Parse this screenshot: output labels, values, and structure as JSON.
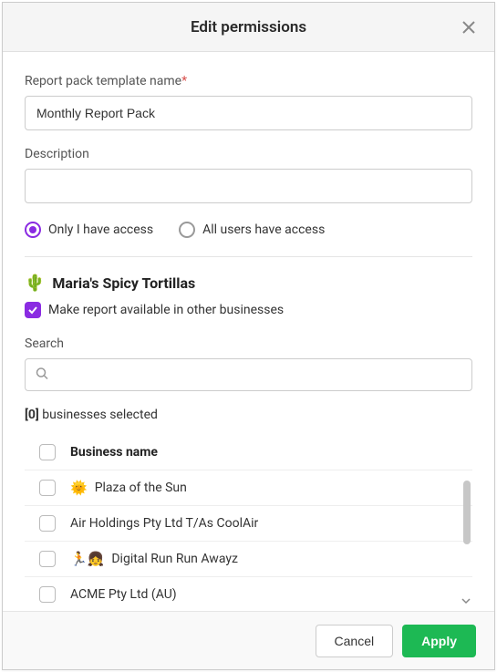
{
  "header": {
    "title": "Edit permissions"
  },
  "fields": {
    "name_label": "Report pack template name",
    "name_value": "Monthly Report Pack",
    "desc_label": "Description",
    "desc_value": ""
  },
  "access": {
    "only_me": "Only I have access",
    "all_users": "All users have access"
  },
  "business": {
    "icon": "🌵",
    "name": "Maria's Spicy Tortillas",
    "share_label": "Make report available in other businesses"
  },
  "search": {
    "label": "Search",
    "value": ""
  },
  "selection": {
    "count": "[0]",
    "suffix": " businesses selected"
  },
  "table": {
    "header": "Business name",
    "rows": [
      {
        "icon": "🌞",
        "name": "Plaza of the Sun"
      },
      {
        "icon": "",
        "name": "Air Holdings Pty Ltd T/As CoolAir"
      },
      {
        "icon": "🏃👧",
        "name": "Digital Run Run Awayz"
      },
      {
        "icon": "",
        "name": "ACME Pty Ltd (AU)"
      }
    ]
  },
  "footer": {
    "cancel": "Cancel",
    "apply": "Apply"
  }
}
